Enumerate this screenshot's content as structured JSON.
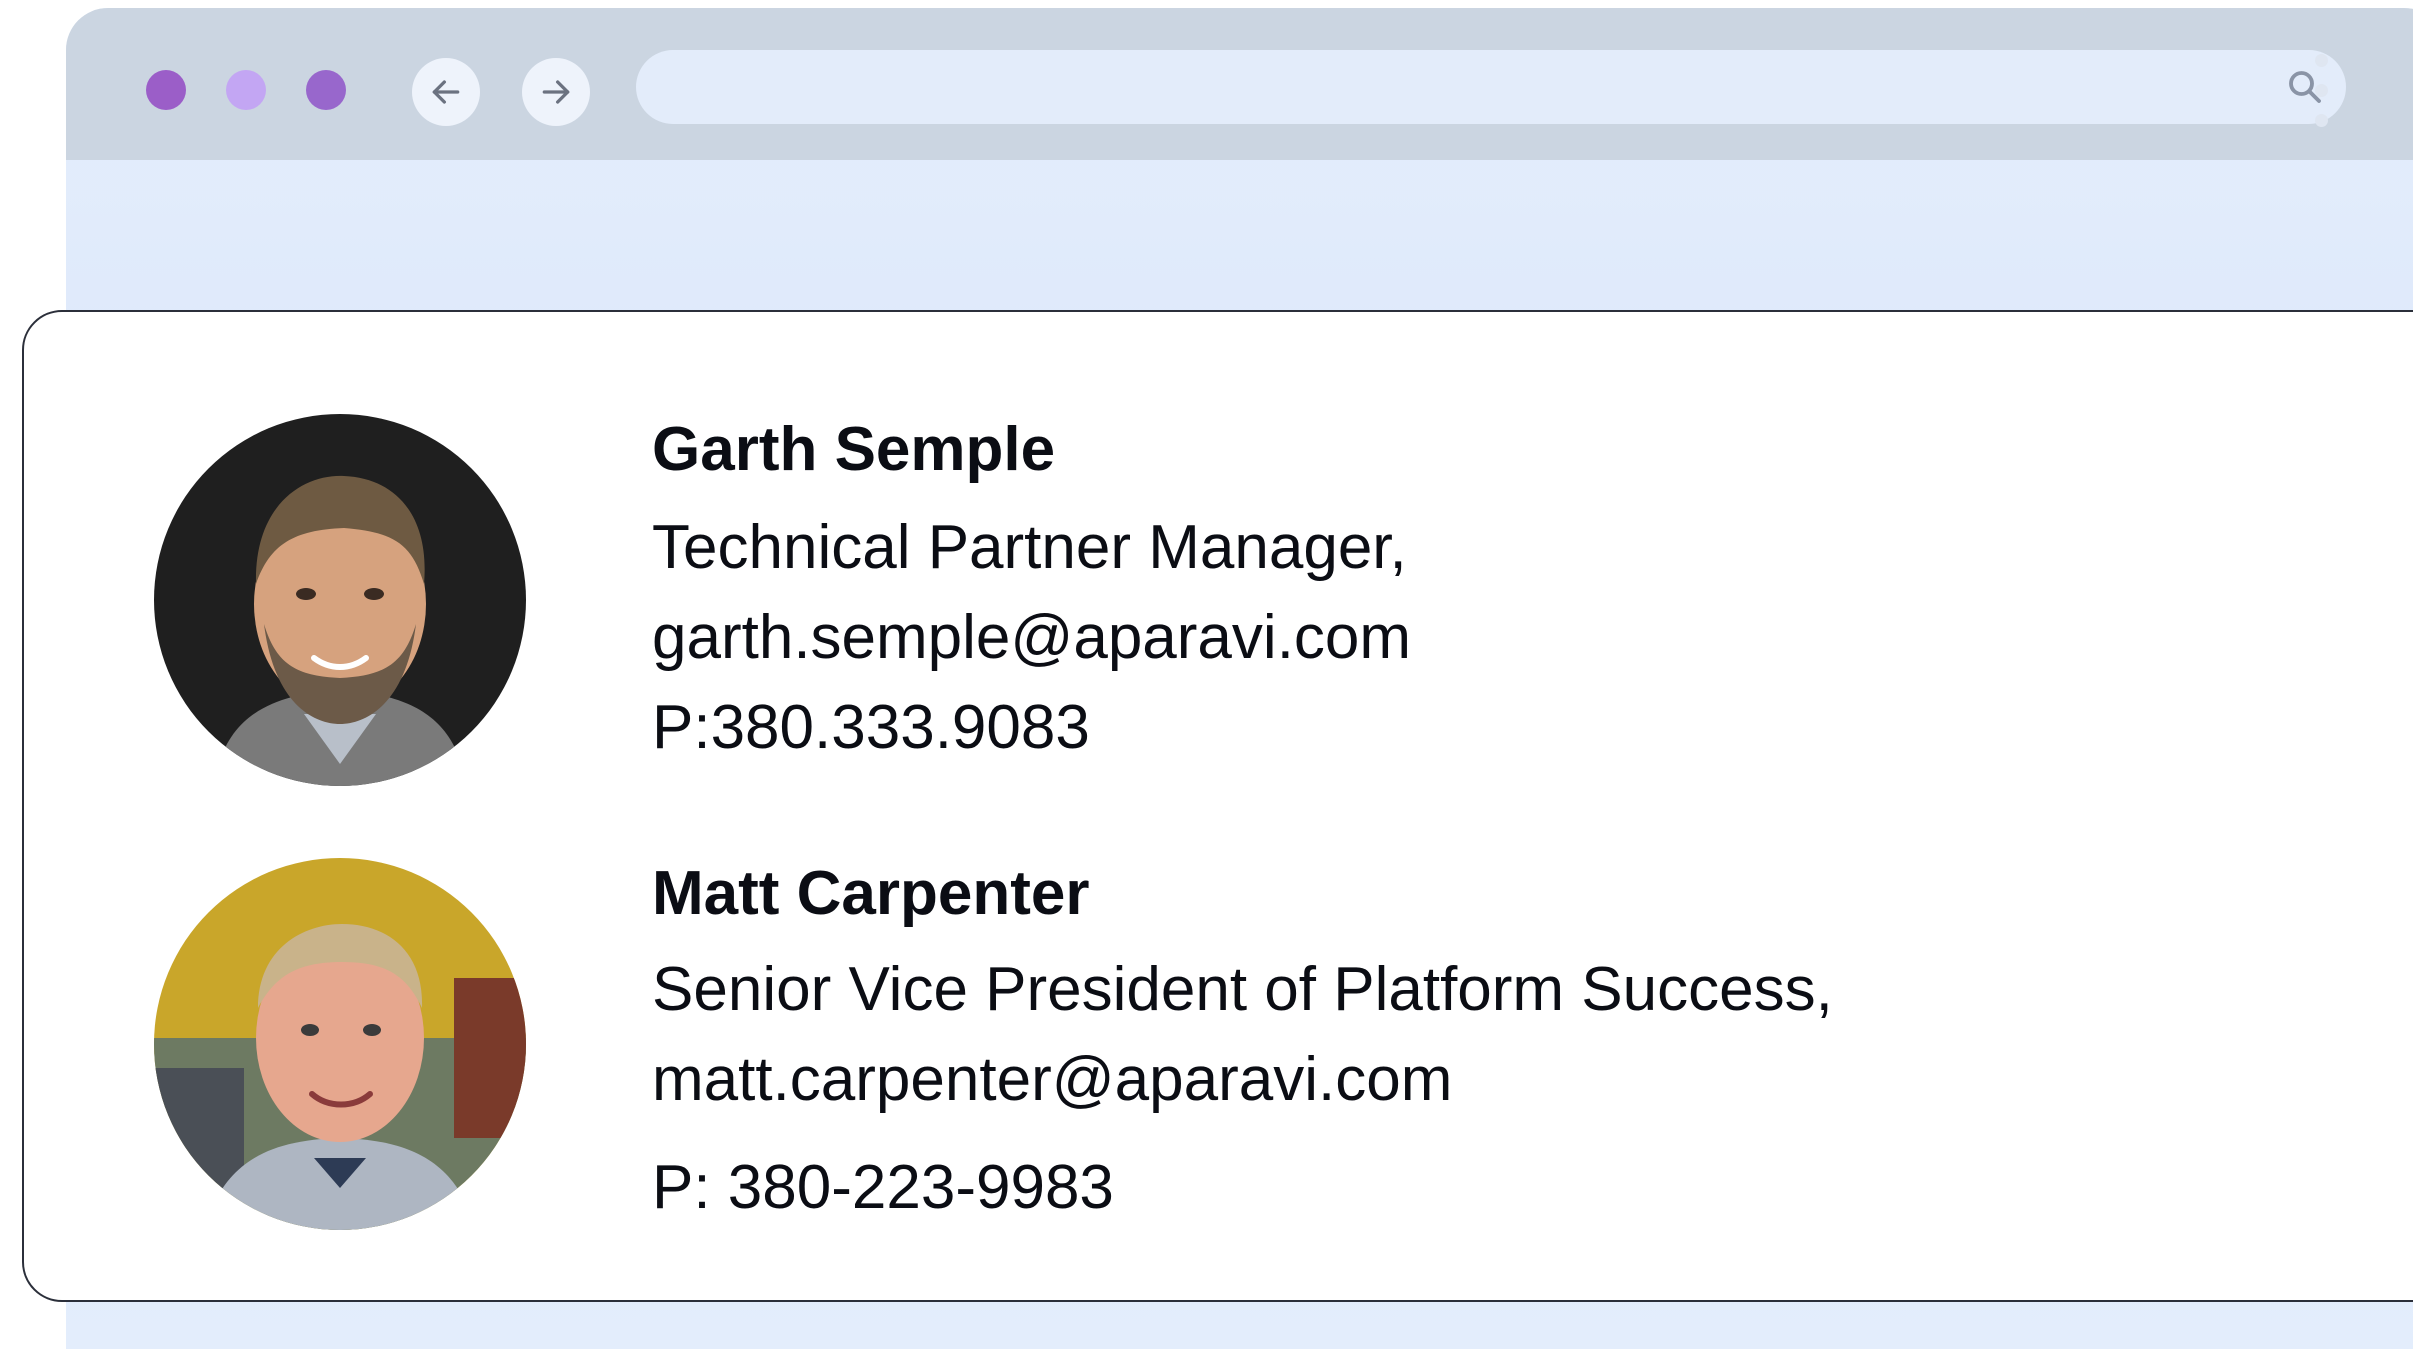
{
  "browser": {
    "window_controls": [
      {
        "name": "close",
        "color": "#9b5ec8"
      },
      {
        "name": "minimize",
        "color": "#c3a6f3"
      },
      {
        "name": "maximize",
        "color": "#9867cc"
      }
    ],
    "back_icon": "arrow-left-icon",
    "forward_icon": "arrow-right-icon",
    "address_value": "",
    "address_placeholder": "",
    "search_icon": "search-icon",
    "menu_icon": "kebab-menu-icon"
  },
  "contacts": [
    {
      "name": "Garth Semple",
      "title": "Technical Partner Manager,",
      "email": "garth.semple@aparavi.com",
      "phone": "P:380.333.9083",
      "avatar_icon": "avatar-photo"
    },
    {
      "name": "Matt Carpenter",
      "title": "Senior Vice President of Platform Success,",
      "email": "matt.carpenter@aparavi.com",
      "phone": "P: 380-223-9983",
      "avatar_icon": "avatar-photo"
    }
  ]
}
